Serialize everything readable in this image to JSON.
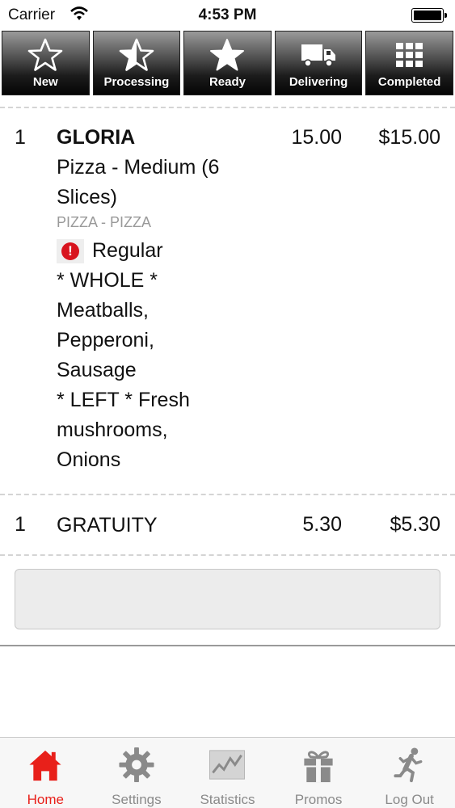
{
  "status_bar": {
    "carrier": "Carrier",
    "time": "4:53 PM"
  },
  "status_tabs": [
    {
      "label": "New",
      "icon": "star-outline-icon"
    },
    {
      "label": "Processing",
      "icon": "star-half-icon"
    },
    {
      "label": "Ready",
      "icon": "star-filled-icon"
    },
    {
      "label": "Delivering",
      "icon": "truck-icon"
    },
    {
      "label": "Completed",
      "icon": "grid-icon"
    }
  ],
  "order_items": [
    {
      "qty": "1",
      "name": "GLORIA",
      "description": "Pizza - Medium (6 Slices)",
      "category": "PIZZA - PIZZA",
      "alert_text": "Regular",
      "modifiers": [
        "* WHOLE *",
        "Meatballs,",
        "Pepperoni,",
        "Sausage",
        "* LEFT * Fresh",
        "mushrooms,",
        "Onions"
      ],
      "unit_price": "15.00",
      "total": "$15.00"
    },
    {
      "qty": "1",
      "name": "GRATUITY",
      "unit_price": "5.30",
      "total": "$5.30"
    }
  ],
  "tab_bar": [
    {
      "label": "Home",
      "icon": "home-icon",
      "active": true
    },
    {
      "label": "Settings",
      "icon": "gear-icon",
      "active": false
    },
    {
      "label": "Statistics",
      "icon": "chart-icon",
      "active": false
    },
    {
      "label": "Promos",
      "icon": "gift-icon",
      "active": false
    },
    {
      "label": "Log Out",
      "icon": "running-man-icon",
      "active": false
    }
  ],
  "colors": {
    "accent": "#e8201a",
    "inactive": "#8a8a8a",
    "alert": "#d8141e"
  }
}
